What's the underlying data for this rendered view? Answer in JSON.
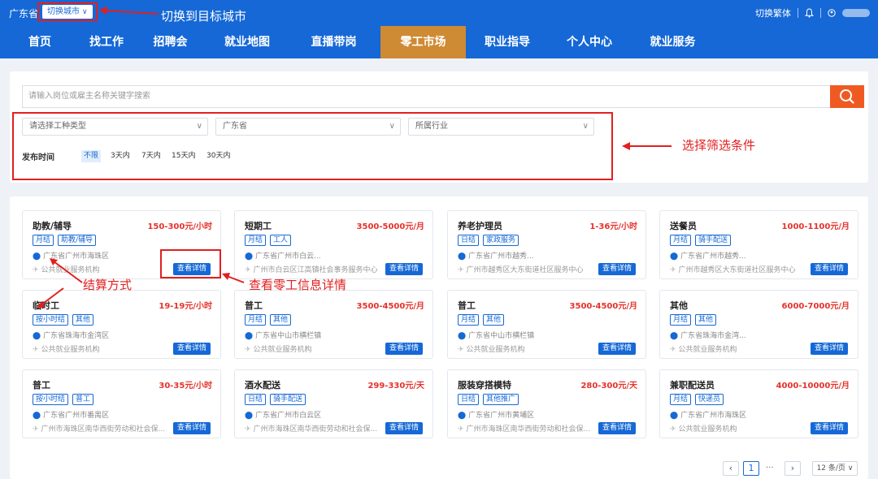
{
  "topbar": {
    "province": "广东省",
    "switch_city": "切换城市",
    "right_switch": "切换繁体"
  },
  "nav": [
    "首页",
    "找工作",
    "招聘会",
    "就业地图",
    "直播带岗",
    "零工市场",
    "职业指导",
    "个人中心",
    "就业服务"
  ],
  "search": {
    "placeholder": "请输入岗位或雇主名称关键字搜索",
    "work_type": "请选择工种类型",
    "province": "广东省",
    "industry": "所属行业",
    "time_label": "发布时间",
    "time_options": [
      "不限",
      "3天内",
      "7天内",
      "15天内",
      "30天内"
    ]
  },
  "cards": [
    {
      "title": "助教/辅导",
      "salary": "150-300元/小时",
      "tags": [
        "月结",
        "助教/辅导"
      ],
      "loc": "广东省广州市海珠区",
      "org": "公共就业服务机构",
      "btn": "查看详情"
    },
    {
      "title": "短期工",
      "salary": "3500-5000元/月",
      "tags": [
        "月结",
        "工人"
      ],
      "loc": "广东省广州市白云...",
      "org": "广州市白云区江高镇社会事务服务中心",
      "btn": "查看详情"
    },
    {
      "title": "养老护理员",
      "salary": "1-36元/小时",
      "tags": [
        "日结",
        "家政服务"
      ],
      "loc": "广东省广州市越秀...",
      "org": "广州市越秀区大东街道社区服务中心",
      "btn": "查看详情"
    },
    {
      "title": "送餐员",
      "salary": "1000-1100元/月",
      "tags": [
        "月结",
        "骑手配送"
      ],
      "loc": "广东省广州市越秀...",
      "org": "广州市越秀区大东街道社区服务中心",
      "btn": "查看详情"
    },
    {
      "title": "临时工",
      "salary": "19-19元/小时",
      "tags": [
        "按小时结",
        "其他"
      ],
      "loc": "广东省珠海市金湾区",
      "org": "公共就业服务机构",
      "btn": "查看详情"
    },
    {
      "title": "普工",
      "salary": "3500-4500元/月",
      "tags": [
        "月结",
        "其他"
      ],
      "loc": "广东省中山市横栏镇",
      "org": "公共就业服务机构",
      "btn": "查看详情"
    },
    {
      "title": "普工",
      "salary": "3500-4500元/月",
      "tags": [
        "月结",
        "其他"
      ],
      "loc": "广东省中山市横栏镇",
      "org": "公共就业服务机构",
      "btn": "查看详情"
    },
    {
      "title": "其他",
      "salary": "6000-7000元/月",
      "tags": [
        "月结",
        "其他"
      ],
      "loc": "广东省珠海市金湾...",
      "org": "公共就业服务机构",
      "btn": "查看详情"
    },
    {
      "title": "普工",
      "salary": "30-35元/小时",
      "tags": [
        "按小时结",
        "普工"
      ],
      "loc": "广东省广州市番禺区",
      "org": "广州市海珠区南华西街劳动和社会保...",
      "btn": "查看详情"
    },
    {
      "title": "酒水配送",
      "salary": "299-330元/天",
      "tags": [
        "日结",
        "骑手配送"
      ],
      "loc": "广东省广州市白云区",
      "org": "广州市海珠区南华西街劳动和社会保...",
      "btn": "查看详情"
    },
    {
      "title": "服装穿搭模特",
      "salary": "280-300元/天",
      "tags": [
        "日结",
        "其他推广"
      ],
      "loc": "广东省广州市黄埔区",
      "org": "广州市海珠区南华西街劳动和社会保...",
      "btn": "查看详情"
    },
    {
      "title": "兼职配送员",
      "salary": "4000-10000元/月",
      "tags": [
        "月结",
        "快递员"
      ],
      "loc": "广东省广州市海珠区",
      "org": "公共就业服务机构",
      "btn": "查看详情"
    }
  ],
  "pager": {
    "current": "1",
    "ellipsis": "···",
    "page_size": "12 条/页"
  },
  "annotations": {
    "switch_target": "切换到目标城市",
    "filter": "选择筛选条件",
    "settlement": "结算方式",
    "detail": "查看零工信息详情"
  },
  "colors": {
    "primary": "#1568d6",
    "active_nav": "#cf8a34",
    "salary": "#e5322b",
    "search_btn": "#f05a22",
    "annotation": "#e21f1f"
  },
  "icons": [
    "bell-icon",
    "user-icon",
    "search-icon",
    "pin-icon",
    "plane-icon",
    "chevron-down-icon",
    "chevron-left-icon",
    "chevron-right-icon"
  ]
}
